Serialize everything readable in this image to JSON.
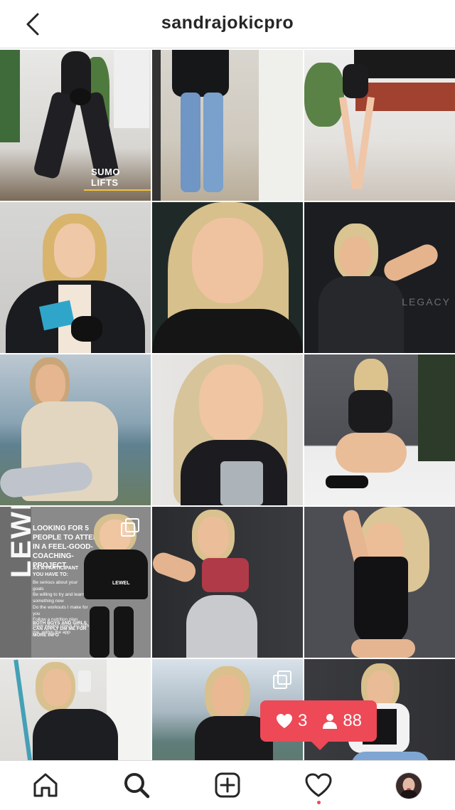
{
  "header": {
    "username": "sandrajokicpro",
    "back_icon": "chevron-left-icon"
  },
  "tiles": {
    "t1": {
      "label": "SUMO LIFTS"
    },
    "t6": {
      "watermark": "LEGACY"
    },
    "t10": {
      "side_text": "LEWEL",
      "headline": "LOOKING FOR 5 PEOPLE TO ATTEND IN A FEEL-GOOD-COACHING-PROJECT",
      "participant_heading": "AS A PARTICIPANT YOU HAVE TO:",
      "bullets": [
        "Be serious about your goals",
        "Be willing to try and learn something new",
        "Do the workouts I make for you",
        "Follow a nutrition plan",
        "Have weekly check ins with me, within the app"
      ],
      "footer": "BOTH BOYS AND GIRLS CAN APPLY DM ME FOR MORE INFO",
      "brand_on_shirt": "LEWEL",
      "multi_icon": "carousel-icon"
    },
    "t14": {
      "multi_icon": "carousel-icon"
    }
  },
  "notification": {
    "likes": "3",
    "followers": "88",
    "like_icon": "heart-filled-icon",
    "follower_icon": "person-icon"
  },
  "nav": {
    "home_icon": "home-icon",
    "search_icon": "search-icon",
    "create_icon": "plus-square-icon",
    "activity_icon": "heart-outline-icon",
    "profile_icon": "avatar"
  },
  "colors": {
    "accent": "#ed4956",
    "text": "#262626",
    "divider": "#dbdbdb"
  }
}
